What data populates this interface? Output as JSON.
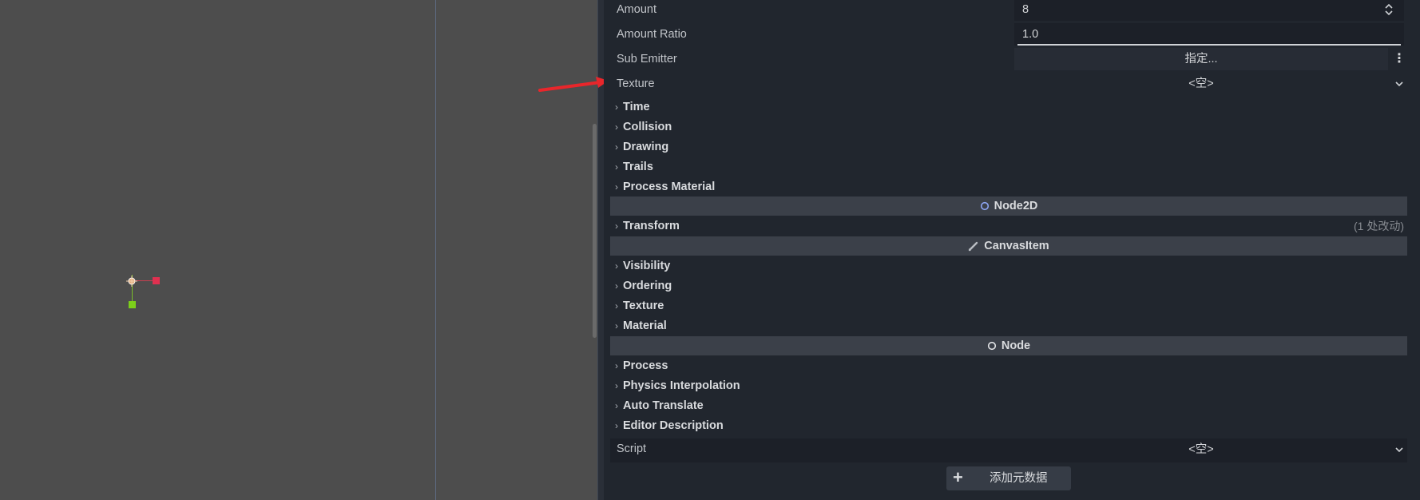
{
  "properties": {
    "amount": {
      "label": "Amount",
      "value": "8"
    },
    "amount_ratio": {
      "label": "Amount Ratio",
      "value": "1.0"
    },
    "sub_emitter": {
      "label": "Sub Emitter",
      "value": "指定..."
    },
    "texture": {
      "label": "Texture",
      "value": "<空>"
    }
  },
  "sections_particles": [
    "Time",
    "Collision",
    "Drawing",
    "Trails",
    "Process Material"
  ],
  "node2d": {
    "title": "Node2D",
    "transform": "Transform",
    "changes": "(1 处改动)"
  },
  "canvas_item": {
    "title": "CanvasItem",
    "sections": [
      "Visibility",
      "Ordering",
      "Texture",
      "Material"
    ]
  },
  "node": {
    "title": "Node",
    "sections": [
      "Process",
      "Physics Interpolation",
      "Auto Translate",
      "Editor Description"
    ]
  },
  "script": {
    "label": "Script",
    "value": "<空>"
  },
  "add_metadata": "添加元数据",
  "colors": {
    "arrow": "#e8262b",
    "node2d_icon": "#8da5f3",
    "accent": "#4aa3df"
  }
}
